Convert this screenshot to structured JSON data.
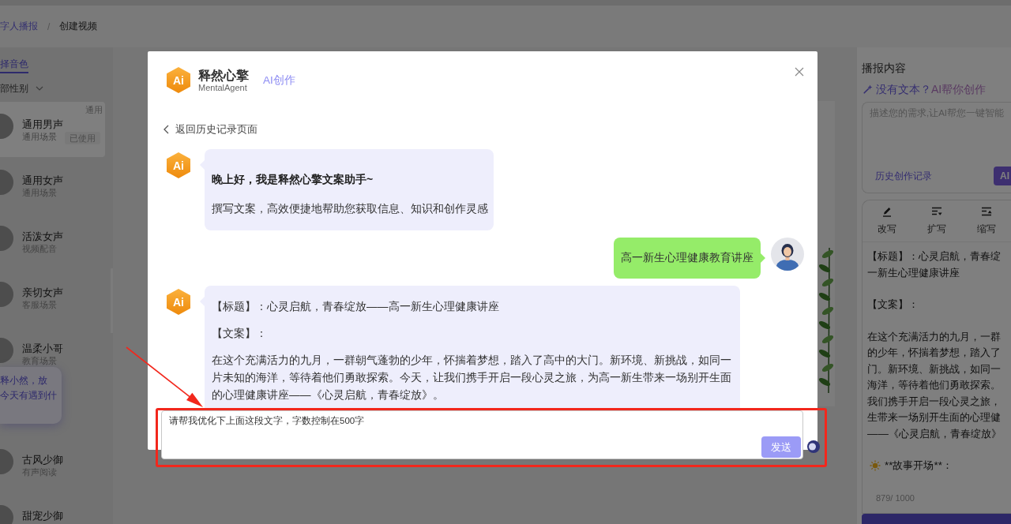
{
  "breadcrumb": {
    "items": [
      "字人播报",
      "创建视频"
    ],
    "separator": "/"
  },
  "voice_panel": {
    "tab": {
      "label": "择音色",
      "selected": true
    },
    "filter": {
      "value": "部性别"
    },
    "voices": [
      {
        "name": "通用男声",
        "scene": "通用场景",
        "selected": true,
        "tag": "通用",
        "badge": "已使用"
      },
      {
        "name": "通用女声",
        "scene": "通用场景",
        "selected": false
      },
      {
        "name": "活泼女声",
        "scene": "视频配音",
        "selected": false
      },
      {
        "name": "亲切女声",
        "scene": "客服场景",
        "selected": false
      },
      {
        "name": "温柔小哥",
        "scene": "教育场景",
        "selected": false
      },
      {
        "name": "古风少御",
        "scene": "有声阅读",
        "selected": false
      },
      {
        "name": "甜宠少御",
        "selected": false
      }
    ]
  },
  "chat_tip": {
    "lines": [
      "释小然，放",
      "今天有遇到什"
    ]
  },
  "content_panel": {
    "title": "播报内容",
    "ai_hint": {
      "lead": "没有文本？",
      "highlight": "AI帮你创作"
    },
    "prompt_field": {
      "placeholder": "描述您的需求,让AI帮您一键智能"
    },
    "history_link": "历史创作记录",
    "ai_button": "AI",
    "tools": [
      {
        "kind": "rewrite",
        "label": "改写"
      },
      {
        "kind": "expand",
        "label": "扩写"
      },
      {
        "kind": "shrink",
        "label": "缩写"
      }
    ],
    "script": [
      [
        "【标题】：心灵启航，青春绽",
        "一新生心理健康讲座"
      ],
      [
        "【文案】："
      ],
      [
        "在这个充满活力的九月，一群",
        "的少年，怀揣着梦想，踏入了",
        "门。新环境、新挑战，如同一",
        "海洋，等待着他们勇敢探索。",
        "我们携手开启一段心灵之旅，",
        "生带来一场别开生面的心理健",
        "——《心灵启航，青春绽放》"
      ]
    ],
    "story_heading": "**故事开场**：",
    "counter": "879/ 1000"
  },
  "dialog": {
    "logo": "Ai",
    "brand": "释然心擎",
    "brand_subtitle": "MentalAgent",
    "section": "AI创作",
    "back_link": "返回历史记录页面",
    "messages": [
      {
        "kind": "assistant",
        "avatar": "Ai",
        "blocks": [
          {
            "kind": "heading",
            "text": "晚上好，我是释然心擎文案助手~"
          },
          {
            "kind": "text",
            "text": "撰写文案，高效便捷地帮助您获取信息、知识和创作灵感"
          }
        ]
      },
      {
        "kind": "user",
        "blocks": [
          {
            "kind": "text",
            "text": "高一新生心理健康教育讲座"
          }
        ]
      },
      {
        "kind": "assistant",
        "avatar": "Ai",
        "blocks": [
          {
            "kind": "text",
            "text": "【标题】：心灵启航，青春绽放——高一新生心理健康讲座"
          },
          {
            "kind": "text",
            "text": "【文案】："
          },
          {
            "kind": "text",
            "text": "在这个充满活力的九月，一群朝气蓬勃的少年，怀揣着梦想，踏入了高中的大门。新环境、新挑战，如同一片未知的海洋，等待着他们勇敢探索。今天，让我们携手开启一段心灵之旅，为高一新生带来一场别开生面的心理健康讲座——《心灵启航，青春绽放》。"
          }
        ]
      }
    ],
    "input": {
      "value": "请帮我优化下上面这段文字，字数控制在500字"
    },
    "send_button": "发送"
  }
}
